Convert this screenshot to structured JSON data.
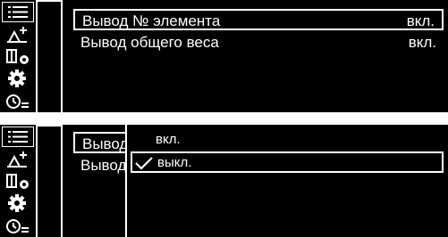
{
  "top_screen": {
    "rows": [
      {
        "label": "Вывод № элемента",
        "value": "вкл."
      },
      {
        "label": "Вывод общего веса",
        "value": "вкл."
      }
    ]
  },
  "bottom_screen": {
    "rows": [
      {
        "label": "Вывод"
      },
      {
        "label": "Вывод"
      }
    ],
    "popup": {
      "options": [
        {
          "label": "вкл.",
          "checked": false
        },
        {
          "label": "выкл.",
          "checked": true
        }
      ]
    }
  },
  "sidebar_icons": [
    "list-icon",
    "scale-add-icon",
    "weight-settings-icon",
    "gear-icon",
    "timer-settings-icon"
  ]
}
